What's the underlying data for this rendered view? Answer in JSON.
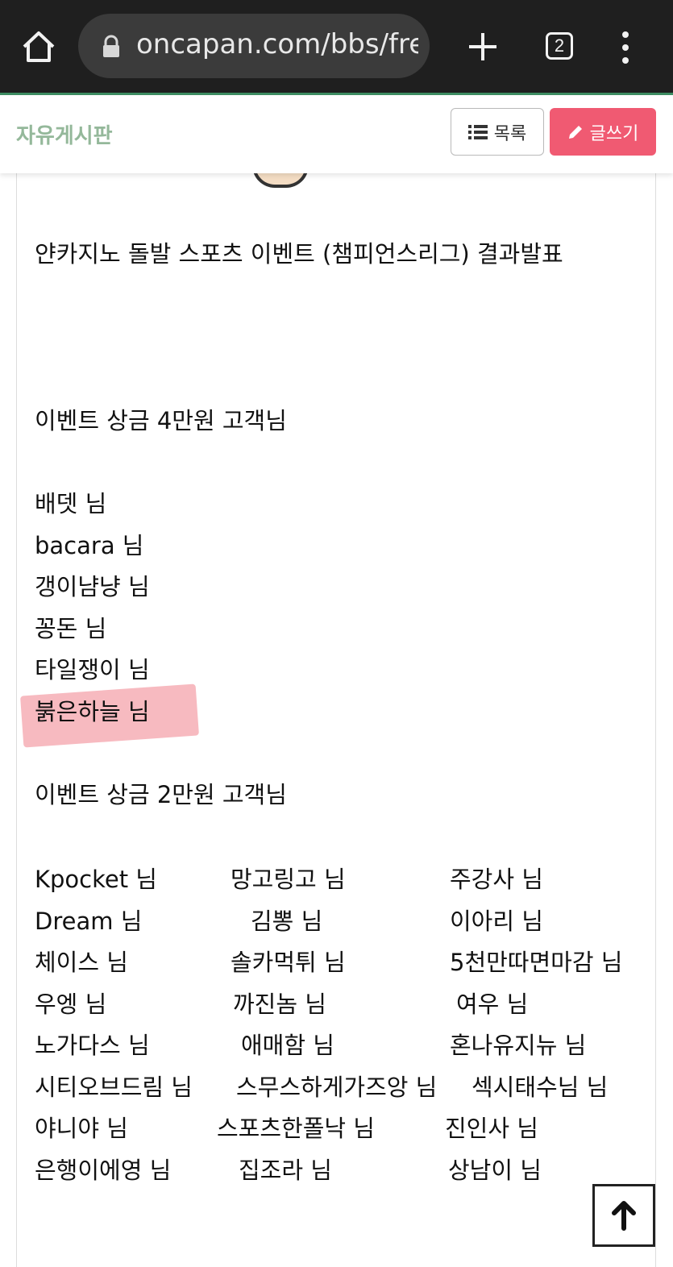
{
  "browser": {
    "url": "oncapan.com/bbs/fre",
    "tab_count": "2",
    "icons": [
      "home-icon",
      "lock-icon",
      "plus-icon",
      "tabs-icon",
      "more-vert-icon"
    ]
  },
  "header": {
    "board_title": "자유게시판",
    "list_label": "목록",
    "write_label": "글쓰기",
    "write_color": "#f05a72"
  },
  "post": {
    "title_line": "얀카지노 돌발 스포츠 이벤트 (챔피언스리그) 결과발표",
    "section1_heading": "이벤트 상금  4만원 고객님",
    "winners_4man": [
      "배뎃 님",
      "bacara 님",
      "갱이냠냥 님",
      "꽁돈 님",
      "타일쟁이 님",
      "붉은하늘 님"
    ],
    "highlighted_winner": "붉은하늘 님",
    "section2_heading": "이벤트 상금  2만원 고객님",
    "winners_2man": [
      [
        "Kpocket 님",
        "망고링고 님",
        "주강사 님"
      ],
      [
        "Dream 님",
        "김뽕 님",
        "이아리 님"
      ],
      [
        "체이스 님",
        "솔카먹튀 님",
        "5천만따면마감 님"
      ],
      [
        "우엥 님",
        "까진놈 님",
        "여우 님"
      ],
      [
        "노가다스 님",
        "애매함 님",
        "혼나유지뉴 님"
      ],
      [
        "시티오브드림 님",
        "스무스하게가즈앙 님",
        "섹시태수님 님"
      ],
      [
        "야니야 님",
        "스포츠한폴낙 님",
        "진인사 님"
      ],
      [
        "은행이에영 님",
        "집조라 님",
        "상남이 님"
      ]
    ]
  },
  "scroll_top_icon": "arrow-up-icon"
}
